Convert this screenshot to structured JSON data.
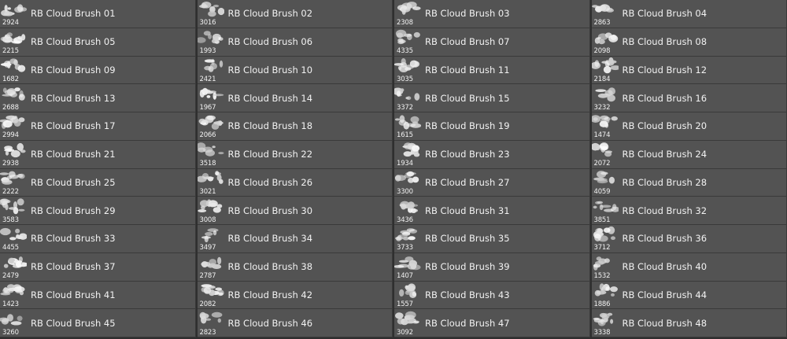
{
  "panel": {
    "brushes": [
      {
        "name": "RB Cloud Brush 01",
        "size": "2924"
      },
      {
        "name": "RB Cloud Brush 02",
        "size": "3016"
      },
      {
        "name": "RB Cloud Brush 03",
        "size": "2308"
      },
      {
        "name": "RB Cloud Brush 04",
        "size": "2863"
      },
      {
        "name": "RB Cloud Brush 05",
        "size": "2215"
      },
      {
        "name": "RB Cloud Brush 06",
        "size": "1993"
      },
      {
        "name": "RB Cloud Brush 07",
        "size": "4335"
      },
      {
        "name": "RB Cloud Brush 08",
        "size": "2098"
      },
      {
        "name": "RB Cloud Brush 09",
        "size": "1682"
      },
      {
        "name": "RB Cloud Brush 10",
        "size": "2421"
      },
      {
        "name": "RB Cloud Brush 11",
        "size": "3035"
      },
      {
        "name": "RB Cloud Brush 12",
        "size": "2184"
      },
      {
        "name": "RB Cloud Brush 13",
        "size": "2688"
      },
      {
        "name": "RB Cloud Brush 14",
        "size": "1967"
      },
      {
        "name": "RB Cloud Brush 15",
        "size": "3372"
      },
      {
        "name": "RB Cloud Brush 16",
        "size": "3232"
      },
      {
        "name": "RB Cloud Brush 17",
        "size": "2994"
      },
      {
        "name": "RB Cloud Brush 18",
        "size": "2066"
      },
      {
        "name": "RB Cloud Brush 19",
        "size": "1615"
      },
      {
        "name": "RB Cloud Brush 20",
        "size": "1474"
      },
      {
        "name": "RB Cloud Brush 21",
        "size": "2938"
      },
      {
        "name": "RB Cloud Brush 22",
        "size": "3518"
      },
      {
        "name": "RB Cloud Brush 23",
        "size": "1934"
      },
      {
        "name": "RB Cloud Brush 24",
        "size": "2072"
      },
      {
        "name": "RB Cloud Brush 25",
        "size": "2222"
      },
      {
        "name": "RB Cloud Brush 26",
        "size": "3021"
      },
      {
        "name": "RB Cloud Brush 27",
        "size": "3300"
      },
      {
        "name": "RB Cloud Brush 28",
        "size": "4059"
      },
      {
        "name": "RB Cloud Brush 29",
        "size": "3583"
      },
      {
        "name": "RB Cloud Brush 30",
        "size": "3008"
      },
      {
        "name": "RB Cloud Brush 31",
        "size": "3436"
      },
      {
        "name": "RB Cloud Brush 32",
        "size": "3851"
      },
      {
        "name": "RB Cloud Brush 33",
        "size": "4455"
      },
      {
        "name": "RB Cloud Brush 34",
        "size": "3497"
      },
      {
        "name": "RB Cloud Brush 35",
        "size": "3733"
      },
      {
        "name": "RB Cloud Brush 36",
        "size": "3712"
      },
      {
        "name": "RB Cloud Brush 37",
        "size": "2479"
      },
      {
        "name": "RB Cloud Brush 38",
        "size": "2787"
      },
      {
        "name": "RB Cloud Brush 39",
        "size": "1407"
      },
      {
        "name": "RB Cloud Brush 40",
        "size": "1532"
      },
      {
        "name": "RB Cloud Brush 41",
        "size": "1423"
      },
      {
        "name": "RB Cloud Brush 42",
        "size": "2082"
      },
      {
        "name": "RB Cloud Brush 43",
        "size": "1557"
      },
      {
        "name": "RB Cloud Brush 44",
        "size": "1886"
      },
      {
        "name": "RB Cloud Brush 45",
        "size": "3260"
      },
      {
        "name": "RB Cloud Brush 46",
        "size": "2823"
      },
      {
        "name": "RB Cloud Brush 47",
        "size": "3092"
      },
      {
        "name": "RB Cloud Brush 48",
        "size": "3338"
      }
    ],
    "thumbnail_icon": "cloud-brush-icon",
    "colors": {
      "row_background": "#535353",
      "divider": "#3a3a3a",
      "text": "#f2f2f2"
    }
  }
}
